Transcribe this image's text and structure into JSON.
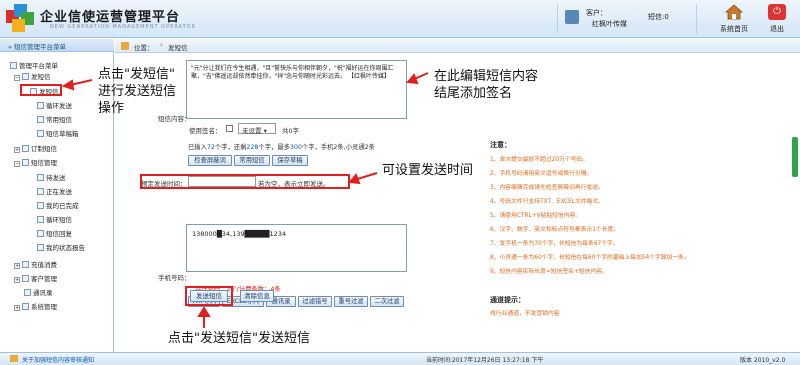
{
  "header": {
    "title": "企业信使运营管理平台",
    "subtitle": "NEW GENERATION  MANAGEMENT  OPERATOR",
    "customer_label": "客户：",
    "customer_name": "红枫叶传媒",
    "sms_label": "短信:0",
    "home_label": "系统首页",
    "exit_label": "退出"
  },
  "sidebar": {
    "header": "» 短信管理平台菜单",
    "root": "管理平台菜单",
    "items": [
      {
        "label": "发短信",
        "level": 1,
        "expanded": true
      },
      {
        "label": "发短信",
        "level": 2
      },
      {
        "label": "循环发送",
        "level": 2
      },
      {
        "label": "常用短信",
        "level": 2
      },
      {
        "label": "短信草稿箱",
        "level": 2
      },
      {
        "label": "订制短信",
        "level": 1,
        "expanded": false
      },
      {
        "label": "短信管理",
        "level": 1,
        "expanded": true
      },
      {
        "label": "待发送",
        "level": 2
      },
      {
        "label": "正在发送",
        "level": 2
      },
      {
        "label": "我的已完成",
        "level": 2
      },
      {
        "label": "循环短信",
        "level": 2
      },
      {
        "label": "短信回复",
        "level": 2
      },
      {
        "label": "我的状态报告",
        "level": 2
      },
      {
        "label": "充值消费",
        "level": 1,
        "expanded": false
      },
      {
        "label": "客户管理",
        "level": 1,
        "expanded": false
      },
      {
        "label": "通讯录",
        "level": 1,
        "expanded": false
      },
      {
        "label": "系统管理",
        "level": 1,
        "expanded": false
      }
    ]
  },
  "breadcrumb": {
    "label": "位置：",
    "arrow": "›",
    "page": "发短信"
  },
  "form": {
    "content_label": "短信内容：",
    "content_text": "\"元\"分让我们在今生相遇，\"旦\"誓快乐与你相伴朝夕，\"祝\"福好运在你周围汇聚，\"吉\"佛遥远却依然牵挂你，\"祥\"念与你随时光彩远去。 【红枫叶传媒】",
    "signature_label": "使用签名：",
    "signature_select": "未设置",
    "signature_count": "共0字",
    "count_prefix": "已输入",
    "count_chars": "72",
    "count_mid": "个字，还剩",
    "count_remaining": "228",
    "count_mid2": "个字，最多",
    "count_max": "300",
    "count_suffix": "个字，手机2条,小灵通2条",
    "btn_check_words": "检查屏蔽词",
    "btn_common_sms": "常用短信",
    "btn_save_draft": "保存草稿",
    "schedule_label": "预定发送时间：",
    "schedule_value": "",
    "schedule_hint": "若为空，表示立即发送。",
    "phone_label": "手机号码：",
    "phone_numbers": "138000█34,139█████1234",
    "phone_count": "共计号码：2个/计费条数：4条",
    "btn_txt_import": "TXT导入",
    "btn_excel_import": "EXCEL导入",
    "btn_contacts": "通讯录",
    "btn_filter_invalid": "过滤错号",
    "btn_filter_dup": "重号过滤",
    "btn_filter_twice": "二次过滤",
    "btn_send": "发送短信",
    "btn_clear": "清除信息"
  },
  "notes": {
    "title": "注意：",
    "items": [
      "1、单次提交最好不超过20万个号码。",
      "2、手机号码请用英文逗号或换行分隔。",
      "3、内容编辑完成请先检查屏蔽词再行发送。",
      "4、号码文件只支持TXT、EXCEL文件格式。",
      "5、请使用CTRL+V粘贴短信内容。",
      "6、汉字、数字、英文和标点符号都表示1个长度。",
      "7、发手机一条为70个字，长短信为每条67个字。",
      "8、小灵通一条为60个字，长短信在每60个字的基础上每加54个字算加一条。",
      "9、短信内容实际长度=短信签名+短信内容。"
    ],
    "channel_title": "通道提示：",
    "channel_text": "线行业通道，不发营销内容"
  },
  "annotations": {
    "click_send_sms": "点击\"发短信\"\n进行发送短信\n操作",
    "edit_content": "在此编辑短信内容\n结尾添加签名",
    "set_time": "可设置发送时间",
    "click_send": "点击\"发送短信\"发送短信"
  },
  "footer": {
    "link": "关于加强短信内容审核通知",
    "time": "当前时间:2017年12月26日 13:27:18 下午",
    "version": "版本 2010_v2.0"
  },
  "colors": {
    "accent_red": "#e02020",
    "note_orange": "#e46818",
    "link_blue": "#0a55b5",
    "header_bg": "#d4e6f6"
  }
}
